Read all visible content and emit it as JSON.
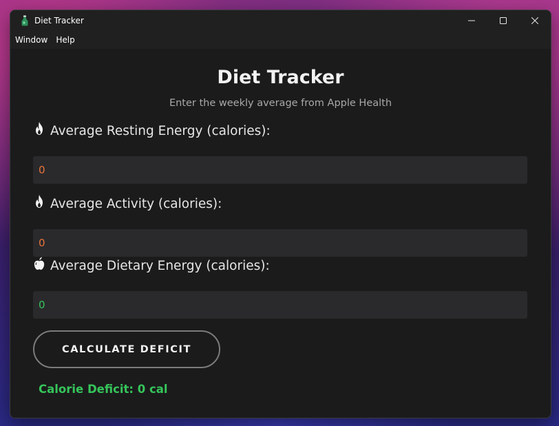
{
  "window": {
    "title": "Diet Tracker",
    "menu": [
      "Window",
      "Help"
    ]
  },
  "main": {
    "heading": "Diet Tracker",
    "subheading": "Enter the weekly average from Apple Health",
    "fields": [
      {
        "icon": "fire-icon",
        "label": "Average Resting Energy (calories):",
        "value": "0",
        "value_color": "#e8733a"
      },
      {
        "icon": "fire-icon",
        "label": "Average Activity (calories):",
        "value": "0",
        "value_color": "#e8733a"
      },
      {
        "icon": "apple-icon",
        "label": "Average Dietary Energy (calories):",
        "value": "0",
        "value_color": "#36c45a"
      }
    ],
    "button_label": "CALCULATE DEFICIT",
    "result_text": "Calorie Deficit: 0 cal",
    "result_color": "#36c45a"
  }
}
